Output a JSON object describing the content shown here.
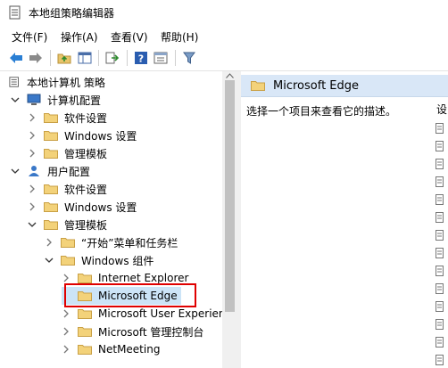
{
  "window": {
    "title": "本地组策略编辑器"
  },
  "menu": [
    "文件(F)",
    "操作(A)",
    "查看(V)",
    "帮助(H)"
  ],
  "toolbar": {
    "icons": [
      "back-icon",
      "forward-icon",
      "up-folder-icon",
      "show-hide-tree-icon",
      "export-list-icon",
      "help-icon",
      "properties-icon",
      "filter-icon"
    ]
  },
  "tree": {
    "root": "本地计算机 策略",
    "computer_config": "计算机配置",
    "cc_software": "软件设置",
    "cc_windows": "Windows 设置",
    "cc_admin": "管理模板",
    "user_config": "用户配置",
    "uc_software": "软件设置",
    "uc_windows": "Windows 设置",
    "uc_admin": "管理模板",
    "start_menu": "“开始”菜单和任务栏",
    "windows_components": "Windows 组件",
    "ie": "Internet Explorer",
    "edge": "Microsoft Edge",
    "user_experience": "Microsoft User Experien",
    "mmc": "Microsoft 管理控制台",
    "netmeeting": "NetMeeting"
  },
  "right_pane": {
    "header": "Microsoft Edge",
    "description": "选择一个项目来查看它的描述。",
    "column_stub": "设"
  },
  "colors": {
    "selection_header": "#d9e7f7",
    "highlight_box": "#e00000",
    "folder": "#e8c46a"
  }
}
